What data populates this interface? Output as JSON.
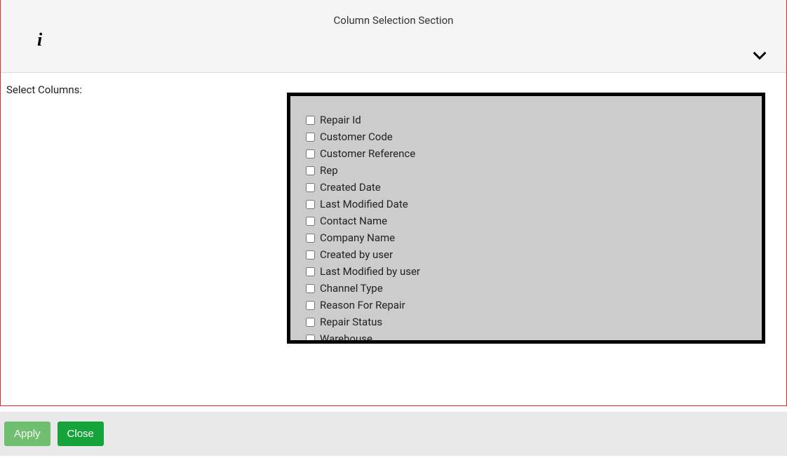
{
  "header": {
    "title": "Column Selection Section"
  },
  "body": {
    "select_label": "Select Columns:"
  },
  "columns": [
    {
      "label": "Repair Id"
    },
    {
      "label": "Customer Code"
    },
    {
      "label": "Customer Reference"
    },
    {
      "label": "Rep"
    },
    {
      "label": "Created Date"
    },
    {
      "label": "Last Modified Date"
    },
    {
      "label": "Contact Name"
    },
    {
      "label": "Company Name"
    },
    {
      "label": "Created by user"
    },
    {
      "label": "Last Modified by user"
    },
    {
      "label": "Channel Type"
    },
    {
      "label": "Reason For Repair"
    },
    {
      "label": "Repair Status"
    },
    {
      "label": "Warehouse"
    }
  ],
  "footer": {
    "apply_label": "Apply",
    "close_label": "Close"
  }
}
